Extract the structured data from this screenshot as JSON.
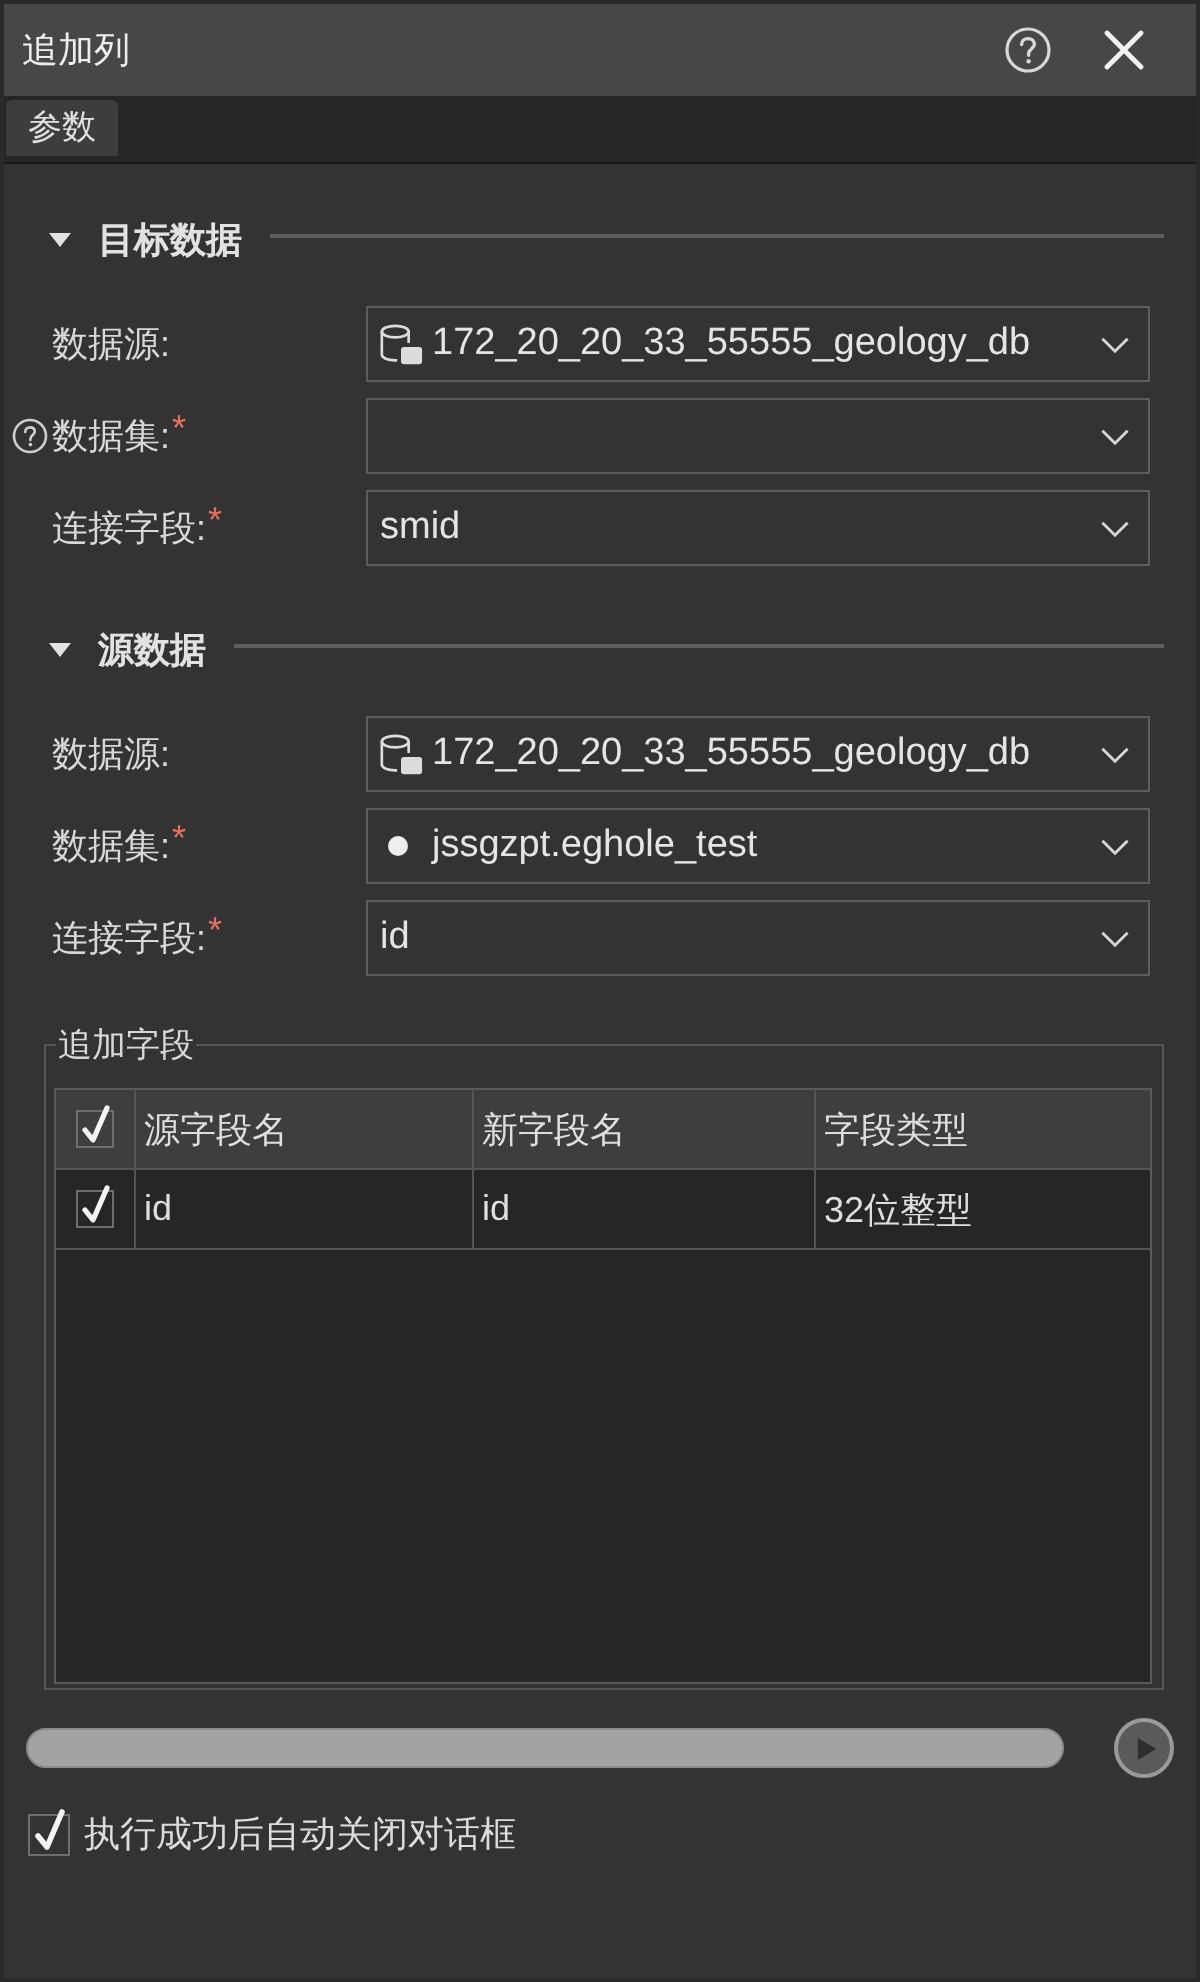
{
  "window": {
    "title": "追加列"
  },
  "tabs": [
    {
      "label": "参数",
      "selected": true
    }
  ],
  "sections": [
    {
      "title": "目标数据",
      "expanded": true,
      "fields": [
        {
          "kind": "datasource",
          "label": "数据源:",
          "value": "172_20_20_33_55555_geology_db",
          "help": false
        },
        {
          "kind": "dataset",
          "label": "数据集:",
          "required_mark": "*",
          "help": true
        },
        {
          "kind": "field",
          "label": "连接字段:",
          "required_mark": "*",
          "value": "smid",
          "help": false
        }
      ]
    },
    {
      "title": "源数据",
      "expanded": true,
      "fields": [
        {
          "kind": "datasource",
          "label": "数据源:",
          "value": "172_20_20_33_55555_geology_db",
          "help": false
        },
        {
          "kind": "dataset",
          "label": "数据集:",
          "required_mark": "*",
          "value": "jssgzpt.eghole_test",
          "help": false
        },
        {
          "kind": "field",
          "label": "连接字段:",
          "required_mark": "*",
          "value": "id",
          "help": false
        }
      ]
    }
  ],
  "append_fields": {
    "title": "追加字段",
    "select_all_checked": true,
    "columns": [
      "源字段名",
      "新字段名",
      "字段类型"
    ],
    "rows": [
      {
        "checked": true,
        "cells": [
          "id",
          "id",
          "32位整型"
        ]
      }
    ]
  },
  "progress": {
    "level": 0
  },
  "auto_close": {
    "label": "执行成功后自动关闭对话框",
    "checked": true
  }
}
